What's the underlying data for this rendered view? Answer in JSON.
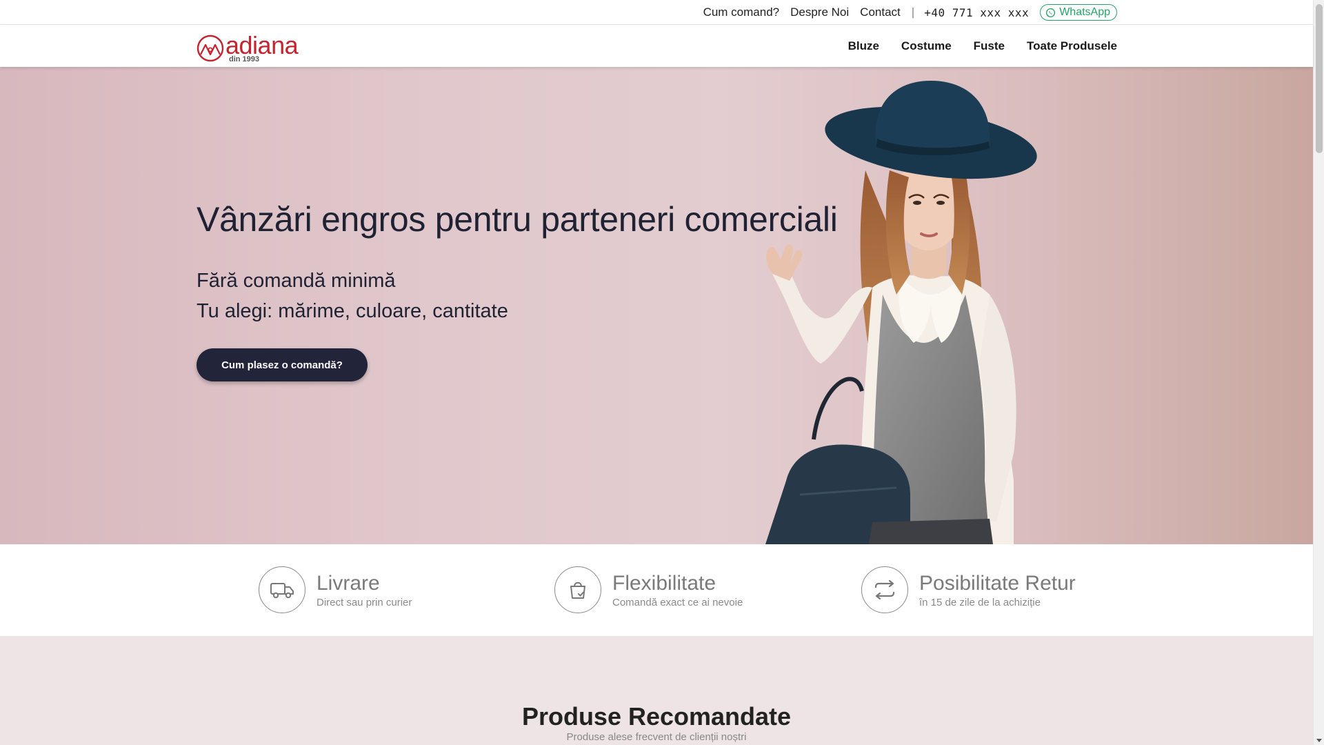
{
  "topbar": {
    "links": [
      "Cum comand?",
      "Despre Noi",
      "Contact"
    ],
    "separator": "|",
    "phone": "+40 771 xxx xxx",
    "whatsapp_label": "WhatsApp",
    "whatsapp_icon": "whatsapp-icon",
    "whatsapp_color": "#25a366"
  },
  "brand": {
    "name": "adiana",
    "tagline": "din 1993",
    "color": "#c4242f"
  },
  "nav": {
    "items": [
      "Bluze",
      "Costume",
      "Fuste",
      "Toate Produsele"
    ]
  },
  "hero": {
    "title": "Vânzări engros pentru parteneri comerciali",
    "line1": "Fără comandă minimă",
    "line2": "Tu alegi: mărime, culoare, cantitate",
    "button": "Cum plasez o comandă?",
    "button_color": "#22243a"
  },
  "features": [
    {
      "icon": "truck-icon",
      "title": "Livrare",
      "subtitle": "Direct sau prin curier"
    },
    {
      "icon": "shopping-bag-check-icon",
      "title": "Flexibilitate",
      "subtitle": "Comandă exact ce ai nevoie"
    },
    {
      "icon": "exchange-arrows-icon",
      "title": "Posibilitate Retur",
      "subtitle": "în 15 de zile de la achiziție"
    }
  ],
  "recommended": {
    "title": "Produse Recomandate",
    "subtitle": "Produse alese frecvent de clienții noștri"
  }
}
